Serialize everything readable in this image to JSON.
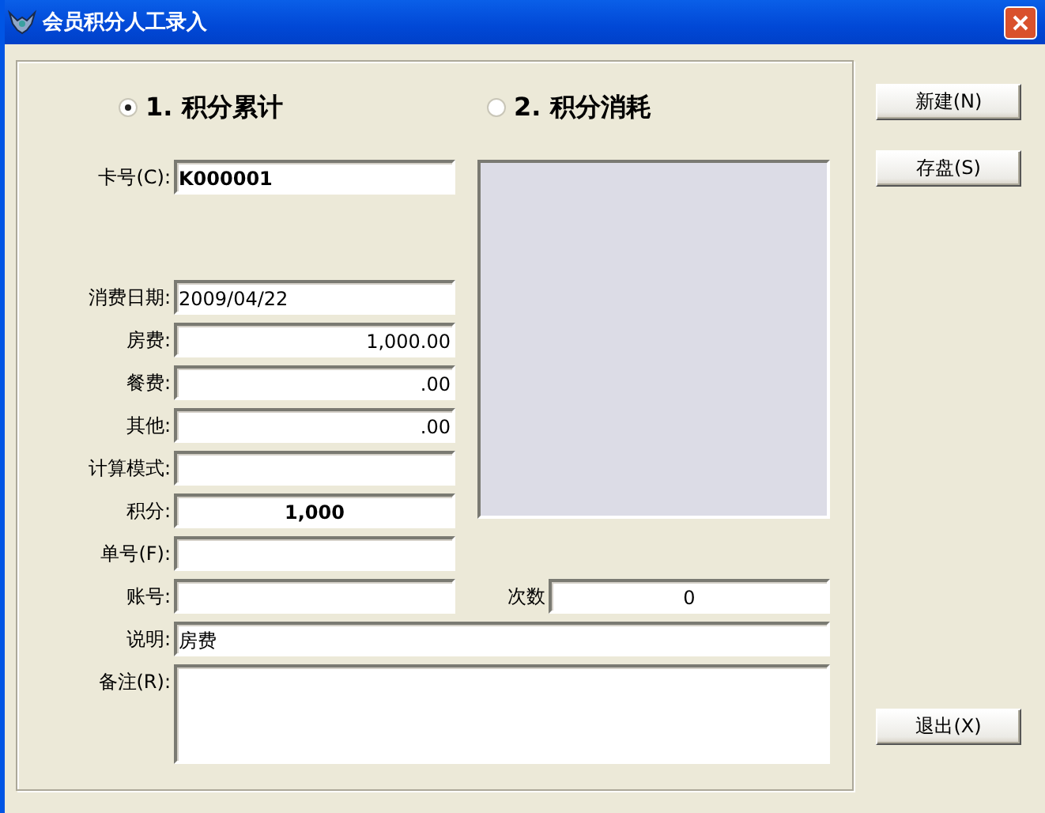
{
  "window": {
    "title": "会员积分人工录入"
  },
  "modes": [
    {
      "label": "1. 积分累计",
      "selected": true
    },
    {
      "label": "2. 积分消耗",
      "selected": false
    }
  ],
  "card_number": {
    "label": "卡号(C):",
    "value": "K000001"
  },
  "fields": [
    {
      "label": "消费日期:",
      "value": "2009/04/22",
      "kind": "text"
    },
    {
      "label": "房费:",
      "value": "1,000.00",
      "kind": "amount"
    },
    {
      "label": "餐费:",
      "value": ".00",
      "kind": "amount"
    },
    {
      "label": "其他:",
      "value": ".00",
      "kind": "amount"
    },
    {
      "label": "计算模式:",
      "kind": "text"
    },
    {
      "label": "积分:",
      "value": "1,000",
      "kind": "total"
    },
    {
      "label": "单号(F):",
      "kind": "text"
    },
    {
      "label": "账号:",
      "kind": "text"
    }
  ],
  "count": {
    "label": "次数",
    "value": "0"
  },
  "description": {
    "label": "说明:",
    "value": "房费"
  },
  "remarks": {
    "label": "备注(R):"
  },
  "buttons": [
    {
      "label": "新建(N)"
    },
    {
      "label": "存盘(S)"
    },
    {
      "label": "退出(X)"
    }
  ]
}
